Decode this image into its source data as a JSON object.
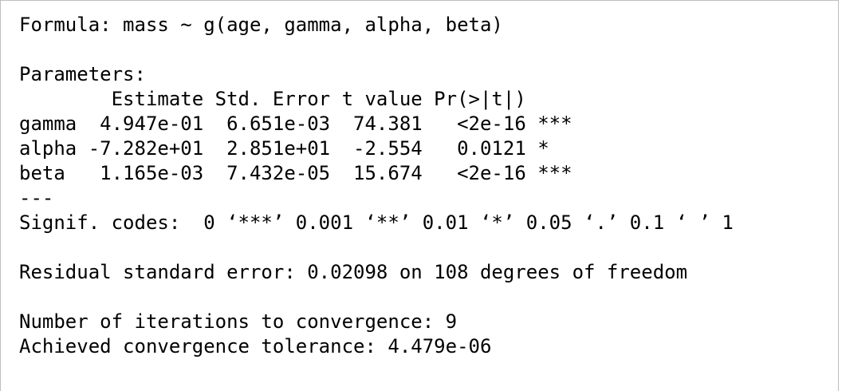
{
  "output": {
    "formula": "Formula: mass ~ g(age, gamma, alpha, beta)",
    "parameters_heading": "Parameters:",
    "table_header": "        Estimate Std. Error t value Pr(>|t|)",
    "rows": [
      "gamma  4.947e-01  6.651e-03  74.381   <2e-16 ***",
      "alpha -7.282e+01  2.851e+01  -2.554   0.0121 *",
      "beta   1.165e-03  7.432e-05  15.674   <2e-16 ***"
    ],
    "separator": "---",
    "signif_codes": "Signif. codes:  0 ‘***’ 0.001 ‘**’ 0.01 ‘*’ 0.05 ‘.’ 0.1 ‘ ’ 1",
    "residual_se": "Residual standard error: 0.02098 on 108 degrees of freedom",
    "iterations": "Number of iterations to convergence: 9",
    "tolerance": "Achieved convergence tolerance: 4.479e-06"
  }
}
